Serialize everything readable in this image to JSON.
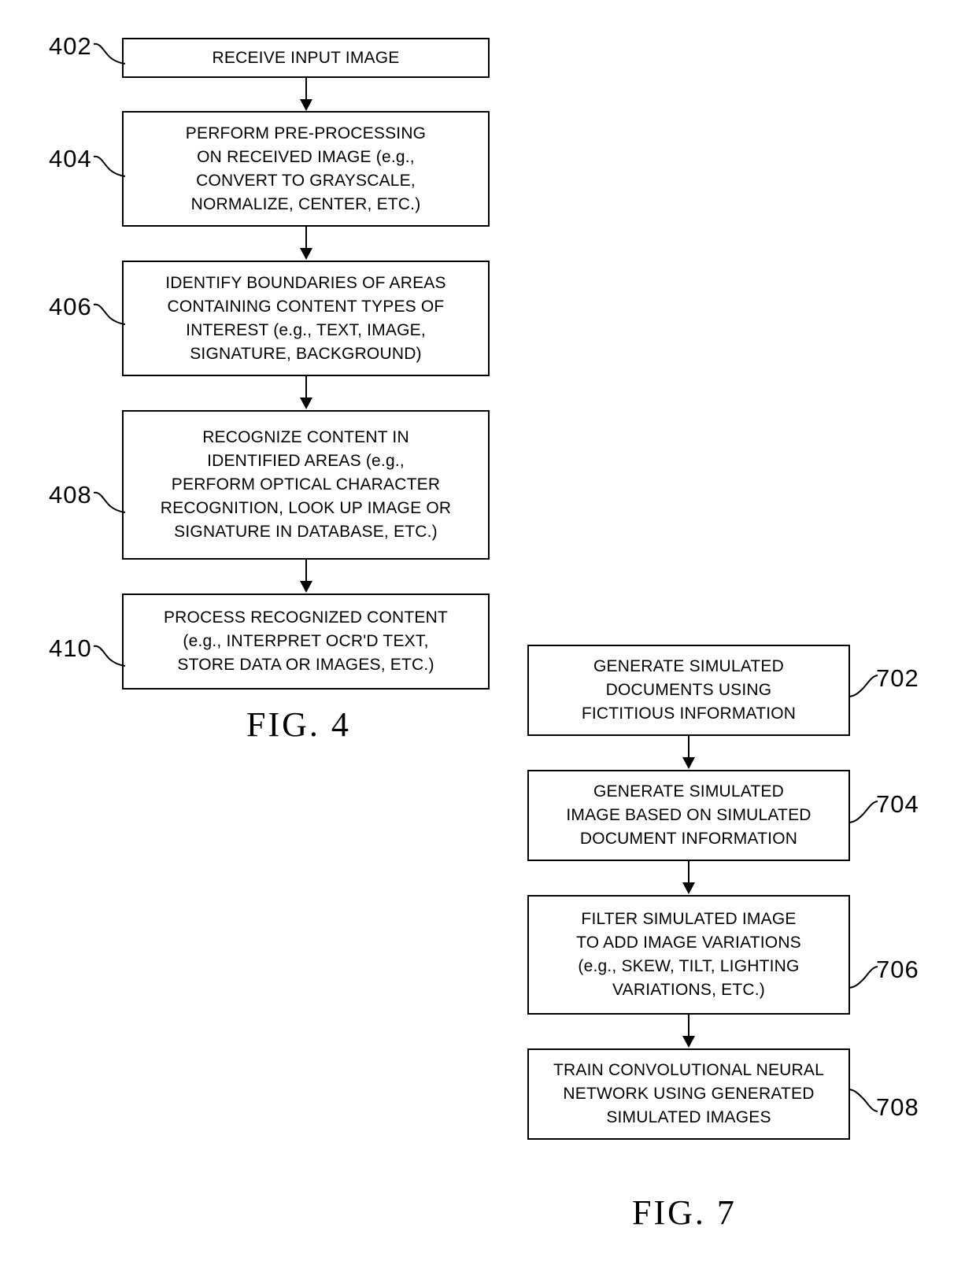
{
  "figures": [
    {
      "id": "fig4",
      "caption": "FIG. 4",
      "steps": [
        {
          "ref": "402",
          "lines": [
            "RECEIVE INPUT IMAGE"
          ]
        },
        {
          "ref": "404",
          "lines": [
            "PERFORM PRE-PROCESSING",
            "ON RECEIVED IMAGE (e.g.,",
            "CONVERT TO GRAYSCALE,",
            "NORMALIZE, CENTER, ETC.)"
          ]
        },
        {
          "ref": "406",
          "lines": [
            "IDENTIFY BOUNDARIES OF AREAS",
            "CONTAINING CONTENT TYPES OF",
            "INTEREST (e.g., TEXT, IMAGE,",
            "SIGNATURE, BACKGROUND)"
          ]
        },
        {
          "ref": "408",
          "lines": [
            "RECOGNIZE CONTENT IN",
            "IDENTIFIED AREAS (e.g.,",
            "PERFORM OPTICAL CHARACTER",
            "RECOGNITION, LOOK UP IMAGE OR",
            "SIGNATURE IN DATABASE, ETC.)"
          ]
        },
        {
          "ref": "410",
          "lines": [
            "PROCESS RECOGNIZED CONTENT",
            "(e.g., INTERPRET OCR'D TEXT,",
            "STORE DATA OR IMAGES, ETC.)"
          ]
        }
      ]
    },
    {
      "id": "fig7",
      "caption": "FIG. 7",
      "steps": [
        {
          "ref": "702",
          "lines": [
            "GENERATE SIMULATED",
            "DOCUMENTS USING",
            "FICTITIOUS INFORMATION"
          ]
        },
        {
          "ref": "704",
          "lines": [
            "GENERATE SIMULATED",
            "IMAGE BASED ON SIMULATED",
            "DOCUMENT INFORMATION"
          ]
        },
        {
          "ref": "706",
          "lines": [
            "FILTER SIMULATED IMAGE",
            "TO ADD IMAGE VARIATIONS",
            "(e.g., SKEW, TILT, LIGHTING",
            "VARIATIONS, ETC.)"
          ]
        },
        {
          "ref": "708",
          "lines": [
            "TRAIN CONVOLUTIONAL NEURAL",
            "NETWORK USING GENERATED",
            "SIMULATED IMAGES"
          ]
        }
      ]
    }
  ],
  "colors": {
    "ink": "#000000",
    "paper": "#ffffff"
  }
}
